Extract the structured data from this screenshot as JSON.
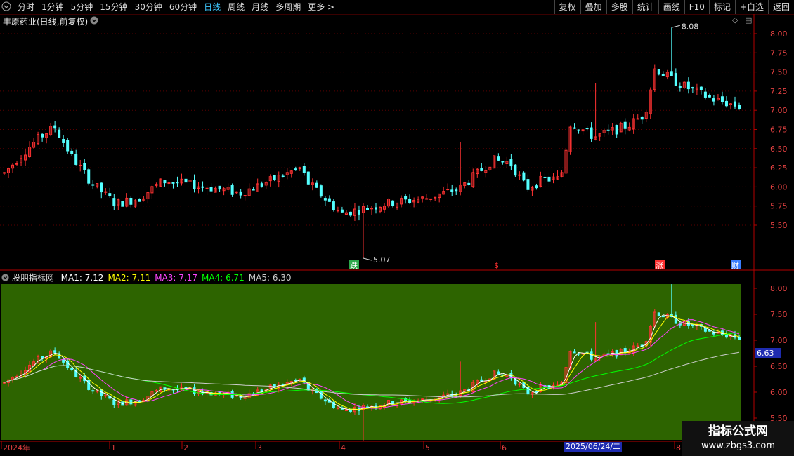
{
  "toolbar": {
    "periods": [
      "分时",
      "1分钟",
      "5分钟",
      "15分钟",
      "30分钟",
      "60分钟",
      "日线",
      "周线",
      "月线",
      "多周期",
      "更多 >"
    ],
    "active_period": "日线",
    "right_buttons": [
      "复权",
      "叠加",
      "多股",
      "统计",
      "画线",
      "F10",
      "标记",
      "+自选",
      "返回"
    ]
  },
  "chart": {
    "title": "丰原药业(日线,前复权)",
    "price_ticks": [
      "8.00",
      "7.75",
      "7.50",
      "7.25",
      "7.00",
      "6.75",
      "6.50",
      "6.25",
      "6.00",
      "5.75",
      "5.50"
    ],
    "max_label": "8.08",
    "min_label": "5.07",
    "markers": {
      "die": "跌",
      "dollar": "$",
      "zhang": "涨",
      "cai": "财"
    }
  },
  "indicator": {
    "name": "股朋指标网",
    "ma": [
      {
        "label": "MA1:",
        "value": "7.12",
        "color": "#ffffff"
      },
      {
        "label": "MA2:",
        "value": "7.11",
        "color": "#ffff00"
      },
      {
        "label": "MA3:",
        "value": "7.17",
        "color": "#ff44ff"
      },
      {
        "label": "MA4:",
        "value": "6.71",
        "color": "#00ff00"
      },
      {
        "label": "MA5:",
        "value": "6.30",
        "color": "#cccccc"
      }
    ],
    "price_ticks": [
      "8.00",
      "7.50",
      "7.00",
      "6.50",
      "6.00",
      "5.50"
    ],
    "cursor_value": "6.63"
  },
  "time_axis": {
    "labels": [
      "2024年",
      "1",
      "2",
      "3",
      "4",
      "5",
      "6",
      "8"
    ],
    "cursor_date": "2025/06/24/二"
  },
  "watermark": {
    "line1": "指标公式网",
    "line2": "www.zbgs3.com"
  },
  "colors": {
    "up": "#ff3232",
    "down": "#54ffff",
    "panel_bg": "#2d6400",
    "axis": "#b40000"
  }
}
